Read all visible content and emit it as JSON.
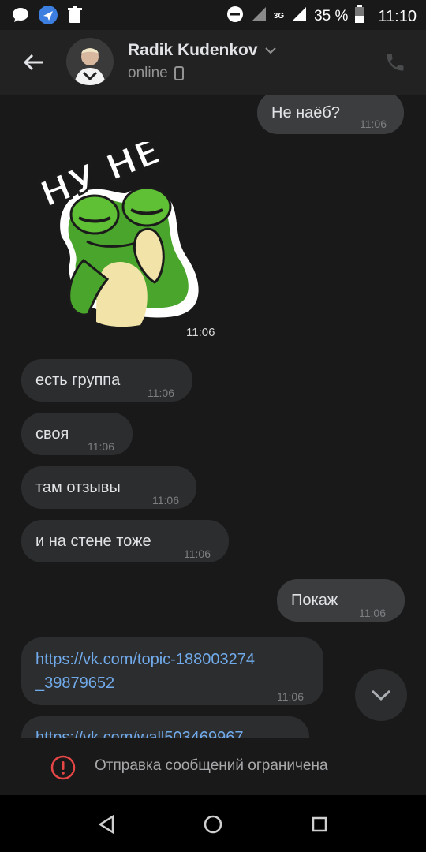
{
  "status_bar": {
    "time": "11:10",
    "battery": "35 %",
    "network": "3G",
    "icons": [
      "message-icon",
      "location-icon",
      "trash-icon",
      "dnd-icon",
      "signal-icon",
      "battery-icon"
    ]
  },
  "header": {
    "contact_name": "Radik Kudenkov",
    "status": "online"
  },
  "messages": [
    {
      "dir": "out",
      "text": "Не наёб?",
      "time": "11:06"
    },
    {
      "dir": "in",
      "type": "sticker",
      "sticker_text": "НУ НЕ",
      "time": "11:06"
    },
    {
      "dir": "in",
      "text": "есть группа",
      "time": "11:06"
    },
    {
      "dir": "in",
      "text": "своя",
      "time": "11:06"
    },
    {
      "dir": "in",
      "text": "там отзывы",
      "time": "11:06"
    },
    {
      "dir": "in",
      "text": "и на стене тоже",
      "time": "11:06"
    },
    {
      "dir": "out",
      "text": "Покаж",
      "time": "11:06"
    },
    {
      "dir": "in",
      "link_line1": "https://vk.com/topic-188003274",
      "link_line2": "_39879652",
      "time": "11:06"
    },
    {
      "dir": "in",
      "link_partial": "https://vk.com/wall503469967"
    }
  ],
  "restriction": {
    "text": "Отправка сообщений ограничена"
  },
  "colors": {
    "background": "#19191a",
    "bubble_in": "#2c2d2e",
    "bubble_out": "#3b3d3f",
    "link": "#71aaeb",
    "alert": "#e64646"
  }
}
